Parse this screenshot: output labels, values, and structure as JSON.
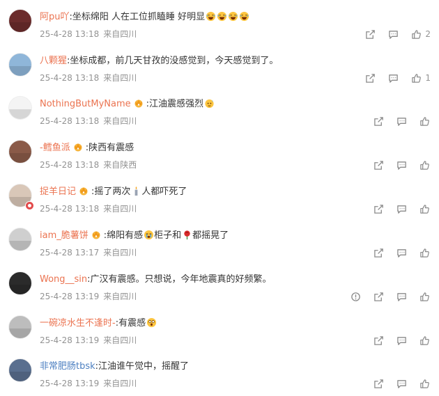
{
  "comments": [
    {
      "user": "阿pu吖",
      "user_color": "#eb7350",
      "content": ":坐标绵阳  人在工位抓瞌睡 好明显",
      "emojis": [
        "laugh",
        "laugh",
        "laugh",
        "laugh"
      ],
      "date": "25-4-28 13:18",
      "location": "来自四川",
      "likes": "2",
      "avatar": "#6b2c2c"
    },
    {
      "user": "八颗猩",
      "user_color": "#eb7350",
      "content": ":坐标成都，前几天甘孜的没感觉到，今天感觉到了。",
      "emojis": [],
      "date": "25-4-28 13:18",
      "location": "来自四川",
      "likes": "1",
      "avatar": "#8fb6d9"
    },
    {
      "user": "NothingButMyName",
      "user_color": "#eb7350",
      "badge": true,
      "content": ":江油震感强烈",
      "emojis": [
        "sweat"
      ],
      "date": "25-4-28 13:18",
      "location": "来自四川",
      "likes": "",
      "avatar": "#f4f4f4"
    },
    {
      "user": "-鳕鱼派",
      "user_color": "#eb7350",
      "badge": true,
      "content": ":陕西有震感",
      "emojis": [],
      "date": "25-4-28 13:18",
      "location": "来自陕西",
      "likes": "",
      "avatar": "#8a5a48"
    },
    {
      "user": "捉羊日记",
      "user_color": "#eb7350",
      "badge": true,
      "vbadge": true,
      "content_pre": ":摇了两次",
      "content": "人都吓死了",
      "emojis_mid": [
        "candle"
      ],
      "emojis": [],
      "date": "25-4-28 13:18",
      "location": "来自四川",
      "likes": "",
      "avatar": "#d9c7b8"
    },
    {
      "user": "iam_脆薯饼",
      "user_color": "#eb7350",
      "badge": true,
      "content_pre": ":绵阳有感",
      "content_mid": "柜子和",
      "content": "都摇晃了",
      "emojis_mid": [
        "cry"
      ],
      "emojis_mid2": [
        "rose"
      ],
      "emojis": [],
      "date": "25-4-28 13:17",
      "location": "来自四川",
      "likes": "",
      "avatar": "#cfcfcf"
    },
    {
      "user": "Wong__sin",
      "user_color": "#eb7350",
      "content": ":广汉有震感。只想说，今年地震真的好频繁。",
      "emojis": [],
      "date": "25-4-28 13:19",
      "location": "来自四川",
      "likes": "",
      "avatar": "#2b2b2b",
      "report": true
    },
    {
      "user": "一碗凉水生不逢时-",
      "user_color": "#eb7350",
      "content": ":有震感",
      "emojis": [
        "shock"
      ],
      "date": "25-4-28 13:19",
      "location": "来自四川",
      "likes": "",
      "avatar": "#bdbdbd"
    },
    {
      "user": "非常肥肠tbsk",
      "user_color": "#4c7fc1",
      "content": ":江油谁午觉中，摇醒了",
      "emojis": [],
      "date": "25-4-28 13:19",
      "location": "来自四川",
      "likes": "",
      "avatar": "#5a6f8f"
    }
  ],
  "icons": {
    "share": "share-icon",
    "comment": "comment-icon",
    "like": "like-icon",
    "report": "report-icon",
    "crown": "crown-badge-icon"
  }
}
